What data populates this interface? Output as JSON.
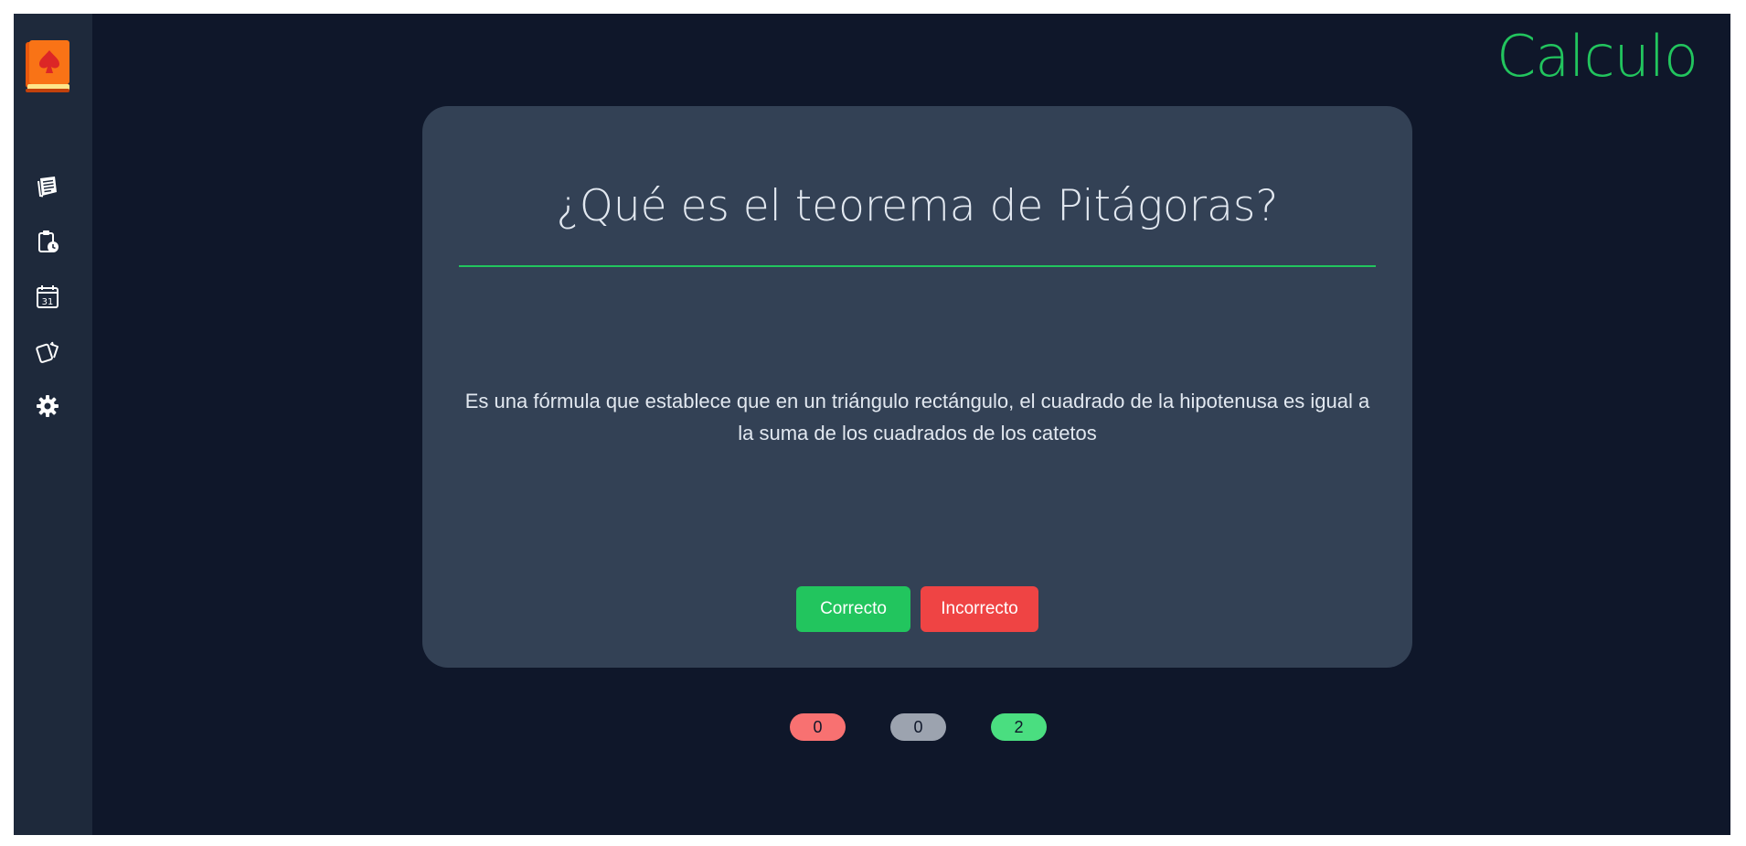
{
  "deck": {
    "title": "Calculo"
  },
  "sidebar": {
    "logo": "spade-book-logo",
    "items": [
      {
        "icon": "notes-icon",
        "label": ""
      },
      {
        "icon": "clipboard-clock-icon",
        "label": ""
      },
      {
        "icon": "calendar-icon",
        "label": ""
      },
      {
        "icon": "cards-icon",
        "label": ""
      },
      {
        "icon": "gear-icon",
        "label": ""
      }
    ],
    "calendar_day": "31"
  },
  "card": {
    "question": "¿Qué es el teorema de Pitágoras?",
    "answer": "Es una fórmula que establece que en un triángulo rectángulo, el cuadrado de la hipotenusa es igual a la suma de los cuadrados de los catetos",
    "buttons": {
      "correct": "Correcto",
      "incorrect": "Incorrecto"
    }
  },
  "counters": {
    "red": "0",
    "gray": "0",
    "green": "2"
  },
  "colors": {
    "background": "#0f172a",
    "sidebar": "#1e293b",
    "card": "#334155",
    "accent": "#22c55e",
    "danger": "#ef4444",
    "logo_orange": "#f97316"
  }
}
